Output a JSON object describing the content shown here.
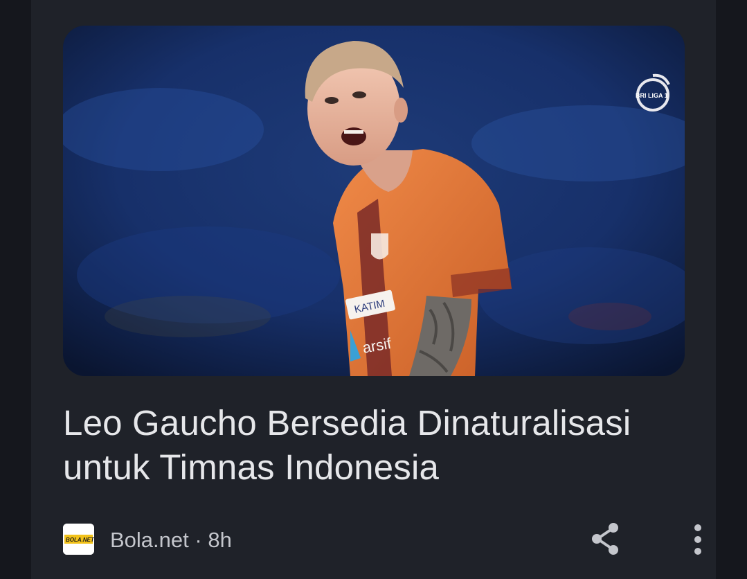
{
  "article": {
    "headline": "Leo Gaucho Bersedia Dinaturalisasi untuk Timnas Indonesia",
    "image_watermark": "BRI LIGA 1",
    "jersey_sponsor_1": "KATIM",
    "jersey_sponsor_2": "arsif"
  },
  "source": {
    "name": "Bola.net",
    "separator": "·",
    "age": "8h",
    "logo_text": "BOLA.NET"
  },
  "actions": {
    "share_icon": "share-icon",
    "more_icon": "more-vert-icon"
  },
  "colors": {
    "page_background": "#15171d",
    "card_background": "#1f2229",
    "headline_text": "#e6e7ea",
    "meta_text": "#c4c6cc",
    "jersey_orange": "#e8793a"
  }
}
